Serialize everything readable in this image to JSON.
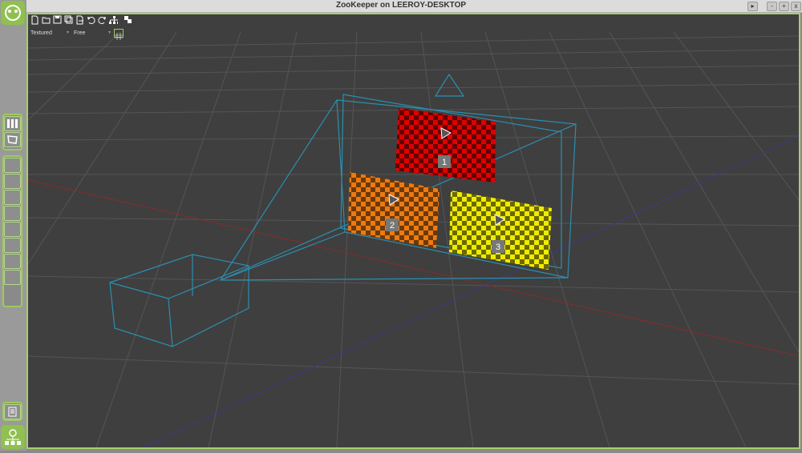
{
  "window": {
    "title": "ZooKeeper on LEEROY-DESKTOP",
    "controls": [
      "▸",
      "-",
      "+",
      "x"
    ]
  },
  "viewport": {
    "shading_mode": "Textured",
    "camera_mode": "Free"
  },
  "screens": [
    {
      "label": "1",
      "color": "#e00000"
    },
    {
      "label": "2",
      "color": "#e87000"
    },
    {
      "label": "3",
      "color": "#e8e000"
    }
  ],
  "colors": {
    "accent": "#9ccc5a",
    "background": "#3f3f3f",
    "grid": "#565656",
    "wireframe": "#2a8fb0"
  }
}
